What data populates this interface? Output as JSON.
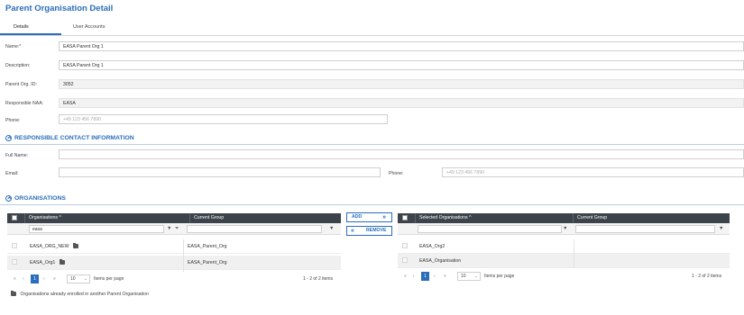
{
  "page": {
    "title": "Parent Organisation Detail"
  },
  "tabs": [
    {
      "label": "Details"
    },
    {
      "label": "User Accounts"
    }
  ],
  "details": {
    "name": {
      "label": "Name:*",
      "value": "EASA Parent Org 1"
    },
    "description": {
      "label": "Description:",
      "value": "EASA Parent Org 1"
    },
    "parent_org_id": {
      "label": "Parent Org. ID:",
      "value": "3052"
    },
    "responsible_naa": {
      "label": "Responsible NAA:",
      "value": "EASA"
    },
    "phone": {
      "label": "Phone:",
      "placeholder": "+49 123 456 7890"
    }
  },
  "contact": {
    "title": "RESPONSIBLE CONTACT INFORMATION",
    "full_name": {
      "label": "Full Name:",
      "value": ""
    },
    "email": {
      "label": "Email:",
      "value": ""
    },
    "phone": {
      "label": "Phone:",
      "placeholder": "+49 123 456 7890"
    }
  },
  "organisations": {
    "title": "ORGANISATIONS",
    "left_grid": {
      "columns": [
        "Organisations ^",
        "Current Group"
      ],
      "filter_value": "easa",
      "rows": [
        {
          "name": "EASA_ORG_NEW",
          "group": "EASA_Parent_Org"
        },
        {
          "name": "EASA_Org1",
          "group": "EASA_Parent_Org"
        }
      ],
      "pager": {
        "current_page": "1",
        "page_size": "10",
        "items_per_page_label": "Items per page",
        "range": "1 - 2 of 2 items"
      }
    },
    "add_button": "ADD",
    "remove_button": "REMOVE",
    "right_grid": {
      "columns": [
        "Selected Organisations ^",
        "Current Group"
      ],
      "rows": [
        {
          "name": "EASA_Org2",
          "group": ""
        },
        {
          "name": "EASA_Organisation",
          "group": ""
        }
      ],
      "pager": {
        "current_page": "1",
        "page_size": "10",
        "items_per_page_label": "Items per page",
        "range": "1 - 2 of 2 items"
      }
    },
    "legend": "Organisations already enrolled in another Parent Organisation"
  },
  "icons": {
    "filter": "filter-icon",
    "folder": "folder-icon",
    "add_arrows": "double-chevron-right-icon",
    "remove_arrows": "double-chevron-left-icon",
    "collapse": "chevron-up-circle-icon"
  },
  "colors": {
    "accent": "#2a6ebb",
    "grid_header": "#3c434a"
  }
}
